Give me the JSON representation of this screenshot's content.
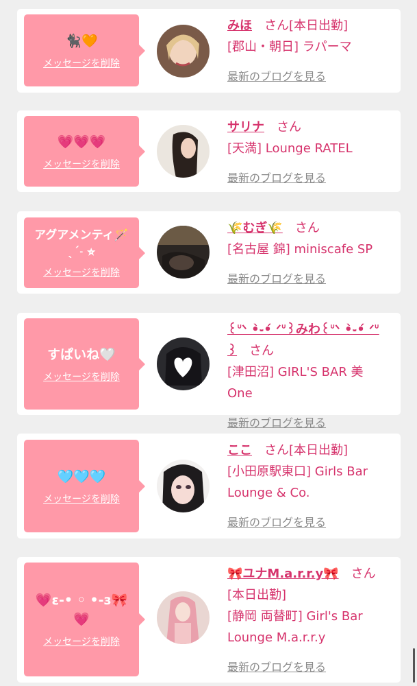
{
  "delete_label": "メッセージを削除",
  "san_label": "さん",
  "blog_label": "最新のブログを見る",
  "accent_color": "#d6336c",
  "bubble_color": "#ff99a8",
  "cards": [
    {
      "message": "🐈‍⬛🧡",
      "name": "みほ",
      "status": "[本日出勤]",
      "shop": "[郡山・朝日] ラパーマ"
    },
    {
      "message": "💗💗💗",
      "name": "サリナ",
      "status": "",
      "shop": "[天満] Lounge RATEL"
    },
    {
      "message": "アグアメンティ🪄 ˎˊ˗ ⭐︎",
      "name": "🌾むぎ🌾",
      "status": "",
      "shop": "[名古屋 錦] miniscafe SP"
    },
    {
      "message": "すぱいね🤍",
      "name": "꒰ᐡᐠ •̀֊•́ ᐟᐡ꒱みわ꒰ᐡᐠ •̀֊•́ ᐟᐡ꒱",
      "status": "",
      "shop": "[津田沼] GIRL'S BAR 美One"
    },
    {
      "message": "🩵🩵🩵",
      "name": "ここ",
      "status": "[本日出勤]",
      "shop": "[小田原駅東口] Girls Bar Lounge & Co."
    },
    {
      "message": "💗ε-• ◦ •-з🎀💗",
      "name": "🎀ユナM.a.r.r.y🎀",
      "status": "[本日出勤]",
      "shop": "[静岡 両替町] Girl's Bar Lounge M.a.r.r.y"
    }
  ]
}
